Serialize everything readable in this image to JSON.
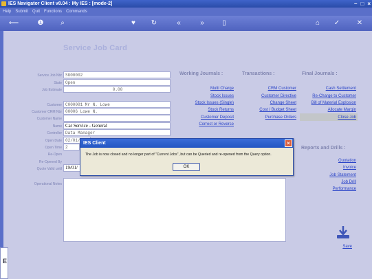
{
  "window": {
    "title": "IES Navigator Client v8.04 : My IES :        [mode-2]",
    "controls": [
      "–",
      "□",
      "×"
    ]
  },
  "menu": [
    "Help",
    "Submit",
    "Quit",
    "Functions",
    "Commands"
  ],
  "toolbar": {
    "icons": [
      "back-arrow-icon",
      "info-icon",
      "search-icon",
      "heart-icon",
      "refresh-icon",
      "rewind-icon",
      "fast-forward-icon",
      "document-icon",
      "home-icon",
      "check-icon",
      "close-icon"
    ],
    "glyphs": [
      "⟵",
      "❶",
      "⌕",
      "♥",
      "↻",
      "«",
      "»",
      "▯",
      "⌂",
      "✓",
      "✕"
    ]
  },
  "page_title": "Service Job Card",
  "fields": [
    {
      "label": "Service Job Nbr",
      "value": "SG00002"
    },
    {
      "label": "State",
      "value": "Open"
    },
    {
      "label": "Job Estimate",
      "value": "0.00"
    },
    {
      "label": "Customer",
      "value": "C000001 Mr N. Lowe"
    },
    {
      "label": "Customer CRM Nbr",
      "value": "00006 Lowe N."
    },
    {
      "label": "Customer Name",
      "value": ""
    },
    {
      "label": "Name",
      "value": "Car Service - General"
    },
    {
      "label": "Controller",
      "value": "Data Manager"
    },
    {
      "label": "Open Date",
      "value": "02/01/"
    },
    {
      "label": "Open Time",
      "value": "2"
    },
    {
      "label": "Re-Open",
      "value": ""
    },
    {
      "label": "Re-Opened By",
      "value": ""
    },
    {
      "label": "Quote Valid until",
      "value": "19/01/"
    },
    {
      "label": "Operational Notes",
      "value": ""
    }
  ],
  "working_journals": {
    "heading": "Working Journals :",
    "links": [
      "Multi Charge",
      "Stock Issues",
      "Stock Issues (Single)",
      "Stock Returns",
      "Customer Deposit",
      "Correct or Reverse"
    ]
  },
  "transactions": {
    "heading": "Transactions :",
    "links": [
      "CRM Customer",
      "Customer Directive",
      "Change Sheet",
      "Cost / Budget Sheet",
      "Purchase Orders"
    ]
  },
  "final_journals": {
    "heading": "Final Journals :",
    "links": [
      "Cash Settlement",
      "Re-Charge to Customer",
      "Bill of Material Explosion",
      "Allocate Margin",
      "Close Job"
    ]
  },
  "reports": {
    "heading": "Reports and Drills :",
    "links": [
      "Quotation",
      "Invoice",
      "Job Statement",
      "Job Drill",
      "Performance"
    ]
  },
  "save": {
    "label": "Save"
  },
  "sidebar_tile": "E",
  "dialog": {
    "title": "IES Client",
    "message": "The Job is now closed and no longer part of \"Current Jobs\", but can be Queried and re-opened from the Query option.",
    "ok_label": "OK",
    "close_glyph": "×"
  }
}
